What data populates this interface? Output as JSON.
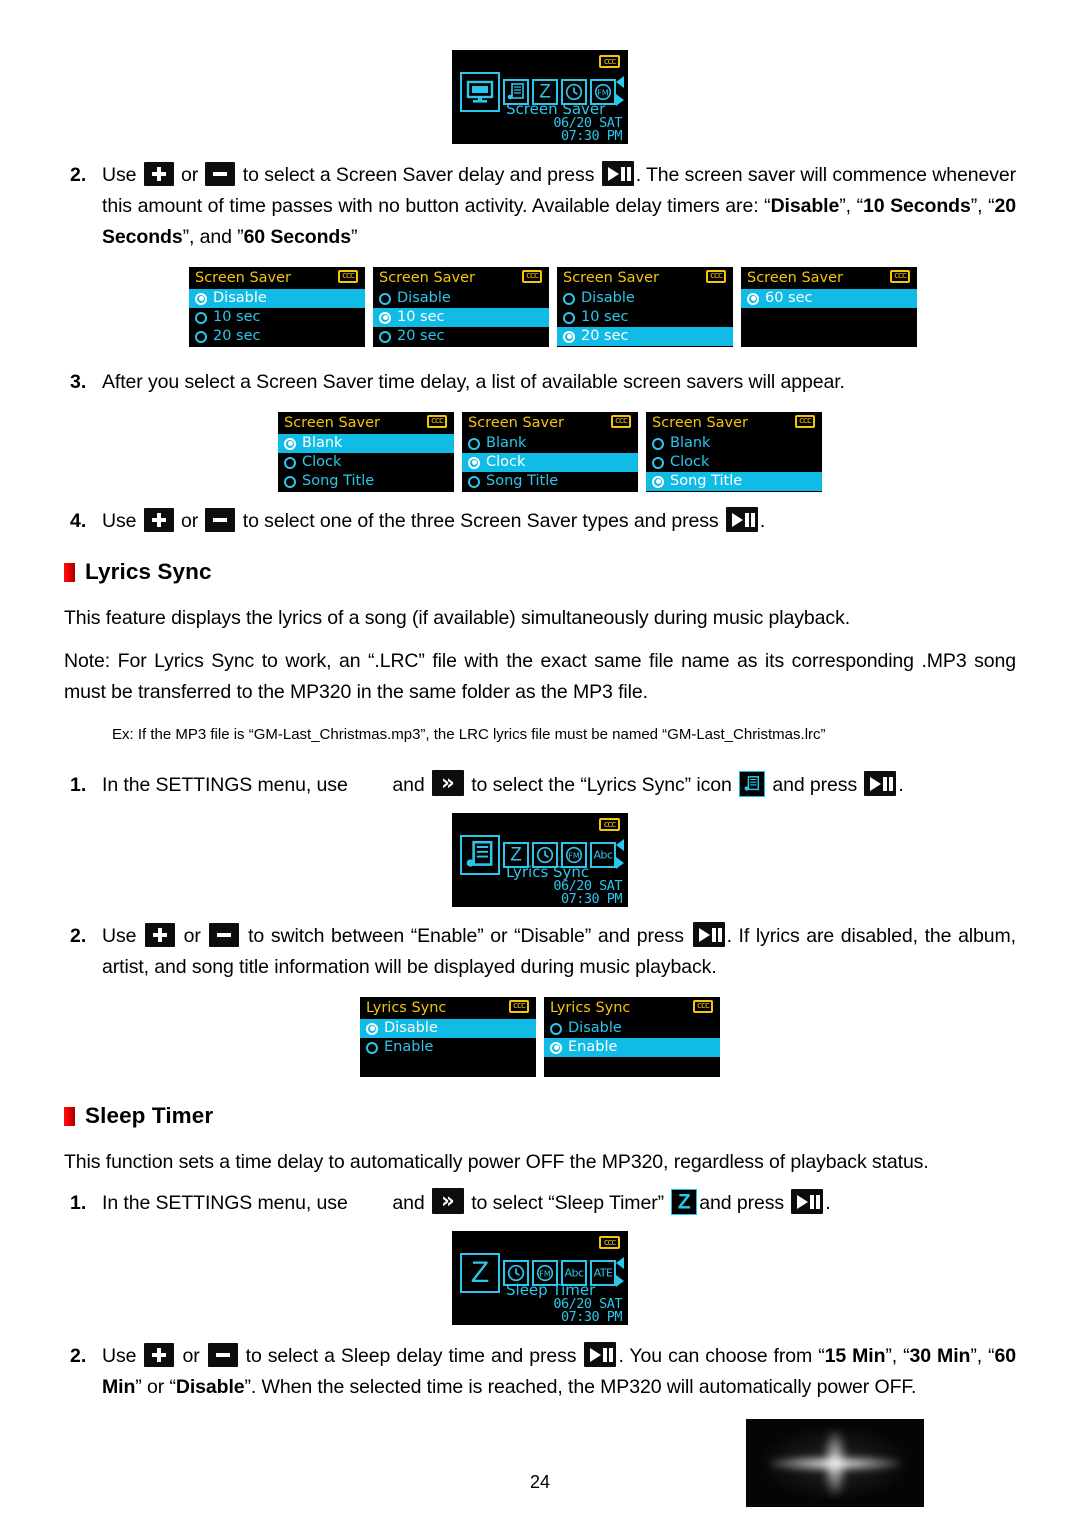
{
  "page": {
    "number": "24"
  },
  "screens": {
    "screen_saver_main": {
      "label": "Screen Saver",
      "date": "06/20 SAT",
      "time": "07:30 PM",
      "lock_badge": "ccc",
      "icons": [
        "monitor-icon",
        "lyrics-icon",
        "sleep-timer-icon",
        "clock-icon",
        "fm-radio-icon"
      ]
    },
    "lyrics_sync_main": {
      "label": "Lyrics Sync",
      "date": "06/20 SAT",
      "time": "07:30 PM",
      "lock_badge": "ccc",
      "icons": [
        "lyrics-icon",
        "sleep-timer-icon",
        "clock-icon",
        "fm-radio-icon",
        "abc-language-icon"
      ]
    },
    "sleep_timer_main": {
      "label": "Sleep Timer",
      "date": "06/20 SAT",
      "time": "07:30 PM",
      "lock_badge": "ccc",
      "icons": [
        "sleep-timer-icon",
        "clock-icon",
        "fm-radio-icon",
        "abc-language-icon",
        "about-info-icon"
      ]
    },
    "delay_menus": {
      "title": "Screen Saver",
      "lock_badge": "ccc",
      "sets": [
        {
          "rows": [
            {
              "label": "Disable",
              "selected": true
            },
            {
              "label": "10 sec",
              "selected": false
            },
            {
              "label": "20 sec",
              "selected": false
            }
          ]
        },
        {
          "rows": [
            {
              "label": "Disable",
              "selected": false
            },
            {
              "label": "10 sec",
              "selected": true
            },
            {
              "label": "20 sec",
              "selected": false
            }
          ]
        },
        {
          "rows": [
            {
              "label": "Disable",
              "selected": false
            },
            {
              "label": "10 sec",
              "selected": false
            },
            {
              "label": "20 sec",
              "selected": true
            }
          ]
        },
        {
          "rows": [
            {
              "label": "60 sec",
              "selected": true
            }
          ]
        }
      ]
    },
    "type_menus": {
      "title": "Screen Saver",
      "lock_badge": "ccc",
      "sets": [
        {
          "rows": [
            {
              "label": "Blank",
              "selected": true
            },
            {
              "label": "Clock",
              "selected": false
            },
            {
              "label": "Song Title",
              "selected": false
            }
          ]
        },
        {
          "rows": [
            {
              "label": "Blank",
              "selected": false
            },
            {
              "label": "Clock",
              "selected": true
            },
            {
              "label": "Song Title",
              "selected": false
            }
          ]
        },
        {
          "rows": [
            {
              "label": "Blank",
              "selected": false
            },
            {
              "label": "Clock",
              "selected": false
            },
            {
              "label": "Song Title",
              "selected": true
            }
          ]
        }
      ]
    },
    "lyrics_menus": {
      "title": "Lyrics Sync",
      "lock_badge": "ccc",
      "sets": [
        {
          "rows": [
            {
              "label": "Disable",
              "selected": true
            },
            {
              "label": "Enable",
              "selected": false
            }
          ]
        },
        {
          "rows": [
            {
              "label": "Disable",
              "selected": false
            },
            {
              "label": "Enable",
              "selected": true
            }
          ]
        }
      ]
    }
  },
  "steps": {
    "ss_step2": {
      "num": "2.",
      "p1": "Use ",
      "p2": " or ",
      "p3": " to select a Screen Saver delay and press ",
      "p4": ". The screen saver will commence whenever this amount of time passes with no button activity. Available delay timers are: “",
      "b1": "Disable",
      "p5": "”, “",
      "b2": "10 Seconds",
      "p6": "”, “",
      "b3": "20 Seconds",
      "p7": "”, and ”",
      "b4": "60 Seconds",
      "p8": "”"
    },
    "ss_step3": {
      "num": "3.",
      "text": "After you select a Screen Saver time delay, a list of available screen savers will appear."
    },
    "ss_step4": {
      "num": "4.",
      "p1": "Use ",
      "p2": " or ",
      "p3": " to select one of the three Screen Saver types and press ",
      "p4": "."
    },
    "ls_step1": {
      "num": "1.",
      "p1": "In the SETTINGS menu, use ",
      "p2": " and ",
      "p3": " to select the “Lyrics Sync” icon ",
      "p4": " and press ",
      "p5": "."
    },
    "ls_step2": {
      "num": "2.",
      "p1": "Use ",
      "p2": " or ",
      "p3": " to switch between “Enable” or “Disable” and press ",
      "p4": ". If lyrics are disabled, the album, artist, and song title information will be displayed during music playback."
    },
    "st_step1": {
      "num": "1.",
      "p1": "In the SETTINGS menu, use ",
      "p2": " and ",
      "p3": " to select “Sleep Timer” ",
      "p4": "and press ",
      "p5": "."
    },
    "st_step2": {
      "num": "2.",
      "p1": "Use ",
      "p2": " or ",
      "p3": " to select a Sleep delay time and press ",
      "p4": ". You can choose from “",
      "b1": "15 Min",
      "p5": "”, “",
      "b2": "30 Min",
      "p6": "”, “",
      "b3": "60 Min",
      "p7": "” or “",
      "b4": "Disable",
      "p8": "”. When the selected time is reached, the MP320 will automatically power OFF."
    }
  },
  "sections": {
    "lyrics_sync": {
      "heading": "Lyrics Sync",
      "para1": "This feature displays the lyrics of a song (if available) simultaneously during music playback.",
      "para2": "Note: For Lyrics Sync to work, an “.LRC” file with the exact same file name as its corresponding .MP3 song must be transferred to the MP320 in the same folder as the MP3 file.",
      "example": "Ex: If the MP3 file is “GM-Last_Christmas.mp3”, the LRC lyrics file must be named “GM-Last_Christmas.lrc”"
    },
    "sleep_timer": {
      "heading": "Sleep Timer",
      "para1": "This function sets a time delay to automatically power OFF the MP320, regardless of playback status."
    }
  },
  "colors": {
    "lcd_cyan": "#2bc6ec",
    "lcd_highlight": "#10bce6",
    "lcd_title_yellow": "#f3c407",
    "heading_bullet_red": "#e00000"
  }
}
